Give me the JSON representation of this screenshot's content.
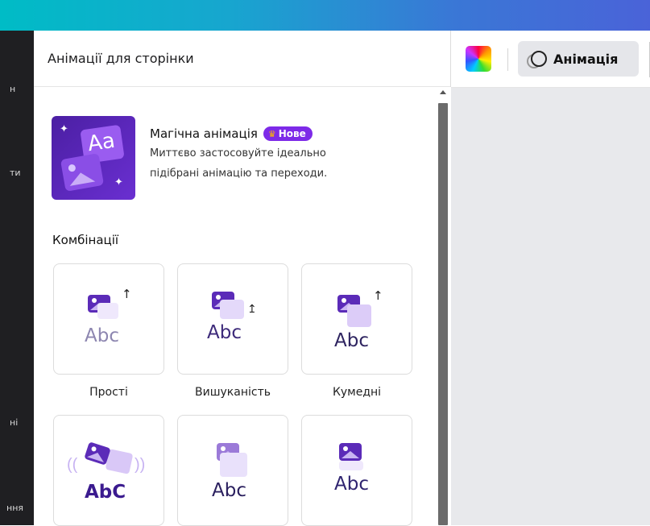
{
  "panel": {
    "title": "Анімації для сторінки"
  },
  "sidebar_fragments": [
    "н",
    "ти",
    "ні",
    "ння"
  ],
  "magic": {
    "title": "Магічна анімація",
    "badge": "Нове",
    "description_line1": "Миттєво застосовуйте ідеально",
    "description_line2": "підібрані анімацію та переходи.",
    "thumb_text": "Aa"
  },
  "combinations": {
    "title": "Комбінації",
    "cards": [
      {
        "label": "Прості",
        "abc": "Abc",
        "icon": "image-icon"
      },
      {
        "label": "Вишуканість",
        "abc": "Abc",
        "icon": "image-icon"
      },
      {
        "label": "Кумедні",
        "abc": "Abc",
        "icon": "image-icon"
      },
      {
        "label": "",
        "abc": "AbC",
        "icon": "image-icon"
      },
      {
        "label": "",
        "abc": "Abc",
        "icon": "image-icon"
      },
      {
        "label": "",
        "abc": "Abc",
        "icon": "image-icon"
      }
    ]
  },
  "toolbar": {
    "animation_label": "Анімація",
    "color_swatch": "rainbow"
  },
  "colors": {
    "accent": "#7d2ae8",
    "topbar_start": "#00bcc6",
    "topbar_end": "#4a63d8"
  }
}
